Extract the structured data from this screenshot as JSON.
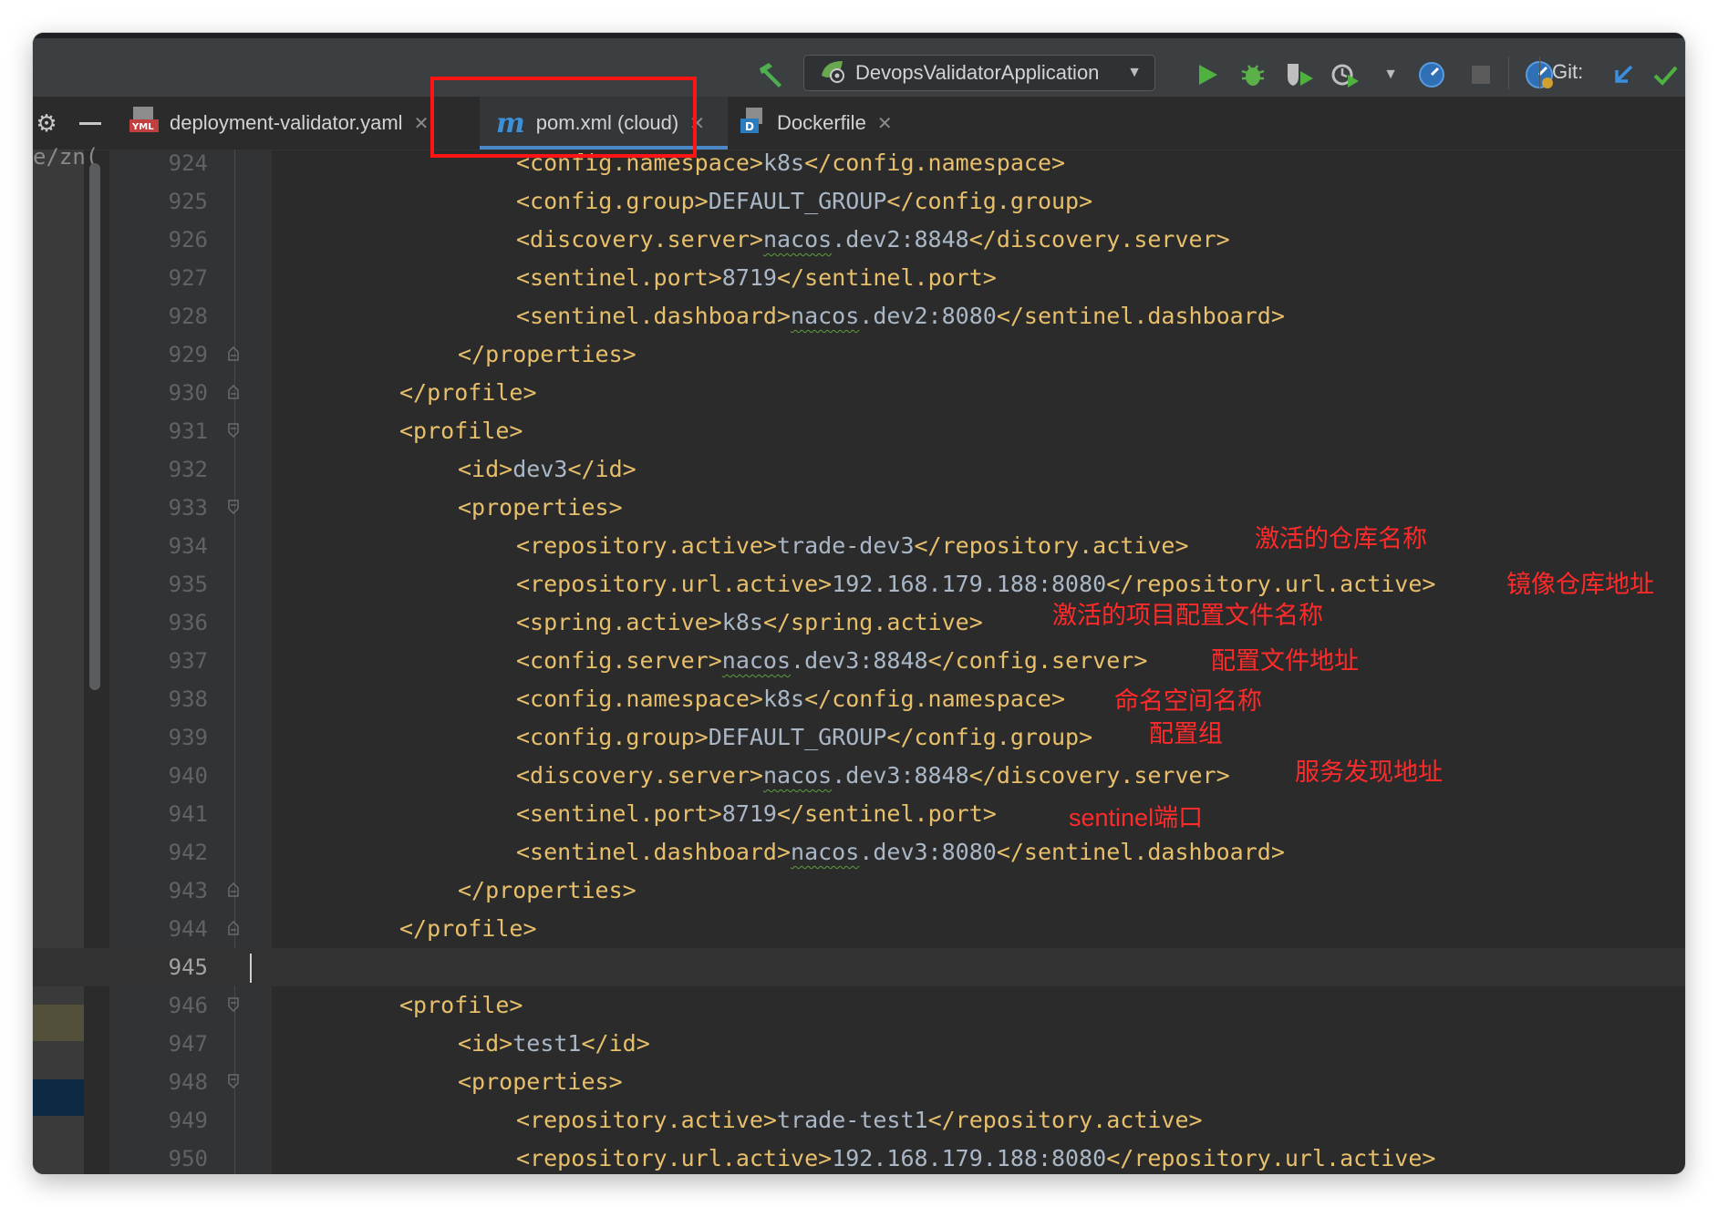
{
  "toolbar": {
    "run_config": "DevopsValidatorApplication",
    "git_label": "Git:",
    "icons": [
      "hammer-icon",
      "spring-boot-icon",
      "run-icon",
      "debug-icon",
      "coverage-icon",
      "profile-icon",
      "chevron-down-icon",
      "speed-icon",
      "stop-icon",
      "update-icon",
      "git-update-icon",
      "git-commit-icon"
    ]
  },
  "tabs": [
    {
      "label": "deployment-validator.yaml",
      "icon": "yaml-icon",
      "active": false
    },
    {
      "label": "pom.xml (cloud)",
      "icon": "maven-icon",
      "active": true
    },
    {
      "label": "Dockerfile",
      "icon": "docker-icon",
      "active": false
    }
  ],
  "left_fragment": "e/zn(",
  "editor": {
    "current_line": 945,
    "lines": [
      {
        "n": 924,
        "indent": 3,
        "open": "<config.namespace>",
        "text": "k8s",
        "close": "</config.namespace>"
      },
      {
        "n": 925,
        "indent": 3,
        "open": "<config.group>",
        "text": "DEFAULT_GROUP",
        "close": "</config.group>"
      },
      {
        "n": 926,
        "indent": 3,
        "open": "<discovery.server>",
        "text": "nacos.dev2:8848",
        "close": "</discovery.server>",
        "squiggle": "nacos"
      },
      {
        "n": 927,
        "indent": 3,
        "open": "<sentinel.port>",
        "text": "8719",
        "close": "</sentinel.port>"
      },
      {
        "n": 928,
        "indent": 3,
        "open": "<sentinel.dashboard>",
        "text": "nacos.dev2:8080",
        "close": "</sentinel.dashboard>",
        "squiggle": "nacos"
      },
      {
        "n": 929,
        "indent": 2,
        "open": "",
        "text": "",
        "close": "</properties>",
        "fold": "end"
      },
      {
        "n": 930,
        "indent": 1,
        "open": "",
        "text": "",
        "close": "</profile>",
        "fold": "end"
      },
      {
        "n": 931,
        "indent": 1,
        "open": "<profile>",
        "text": "",
        "close": "",
        "fold": "start"
      },
      {
        "n": 932,
        "indent": 2,
        "open": "<id>",
        "text": "dev3",
        "close": "</id>"
      },
      {
        "n": 933,
        "indent": 2,
        "open": "<properties>",
        "text": "",
        "close": "",
        "fold": "start"
      },
      {
        "n": 934,
        "indent": 3,
        "open": "<repository.active>",
        "text": "trade-dev3",
        "close": "</repository.active>"
      },
      {
        "n": 935,
        "indent": 3,
        "open": "<repository.url.active>",
        "text": "192.168.179.188:8080",
        "close": "</repository.url.active>"
      },
      {
        "n": 936,
        "indent": 3,
        "open": "<spring.active>",
        "text": "k8s",
        "close": "</spring.active>"
      },
      {
        "n": 937,
        "indent": 3,
        "open": "<config.server>",
        "text": "nacos.dev3:8848",
        "close": "</config.server>",
        "squiggle": "nacos"
      },
      {
        "n": 938,
        "indent": 3,
        "open": "<config.namespace>",
        "text": "k8s",
        "close": "</config.namespace>"
      },
      {
        "n": 939,
        "indent": 3,
        "open": "<config.group>",
        "text": "DEFAULT_GROUP",
        "close": "</config.group>"
      },
      {
        "n": 940,
        "indent": 3,
        "open": "<discovery.server>",
        "text": "nacos.dev3:8848",
        "close": "</discovery.server>",
        "squiggle": "nacos"
      },
      {
        "n": 941,
        "indent": 3,
        "open": "<sentinel.port>",
        "text": "8719",
        "close": "</sentinel.port>"
      },
      {
        "n": 942,
        "indent": 3,
        "open": "<sentinel.dashboard>",
        "text": "nacos.dev3:8080",
        "close": "</sentinel.dashboard>",
        "squiggle": "nacos"
      },
      {
        "n": 943,
        "indent": 2,
        "open": "",
        "text": "",
        "close": "</properties>",
        "fold": "end"
      },
      {
        "n": 944,
        "indent": 1,
        "open": "",
        "text": "",
        "close": "</profile>",
        "fold": "end"
      },
      {
        "n": 945,
        "indent": 0,
        "open": "",
        "text": "",
        "close": ""
      },
      {
        "n": 946,
        "indent": 1,
        "open": "<profile>",
        "text": "",
        "close": "",
        "fold": "start"
      },
      {
        "n": 947,
        "indent": 2,
        "open": "<id>",
        "text": "test1",
        "close": "</id>"
      },
      {
        "n": 948,
        "indent": 2,
        "open": "<properties>",
        "text": "",
        "close": "",
        "fold": "start"
      },
      {
        "n": 949,
        "indent": 3,
        "open": "<repository.active>",
        "text": "trade-test1",
        "close": "</repository.active>"
      },
      {
        "n": 950,
        "indent": 3,
        "open": "<repository.url.active>",
        "text": "192.168.179.188:8080",
        "close": "</repository.url.active>"
      }
    ]
  },
  "annotations": [
    {
      "line": 934,
      "text": "激活的仓库名称"
    },
    {
      "line": 935,
      "text": "镜像仓库地址"
    },
    {
      "line": 936,
      "text": "激活的项目配置文件名称"
    },
    {
      "line": 937,
      "text": "配置文件地址"
    },
    {
      "line": 938,
      "text": "命名空间名称"
    },
    {
      "line": 939,
      "text": "配置组"
    },
    {
      "line": 940,
      "text": "服务发现地址"
    },
    {
      "line": 941,
      "text": "sentinel端口"
    }
  ],
  "colors": {
    "editor_bg": "#2b2b2b",
    "tag": "#e8bf6a",
    "text": "#a9b7c6",
    "annotation": "#ff2a2a",
    "highlight_box": "#ff1414"
  }
}
